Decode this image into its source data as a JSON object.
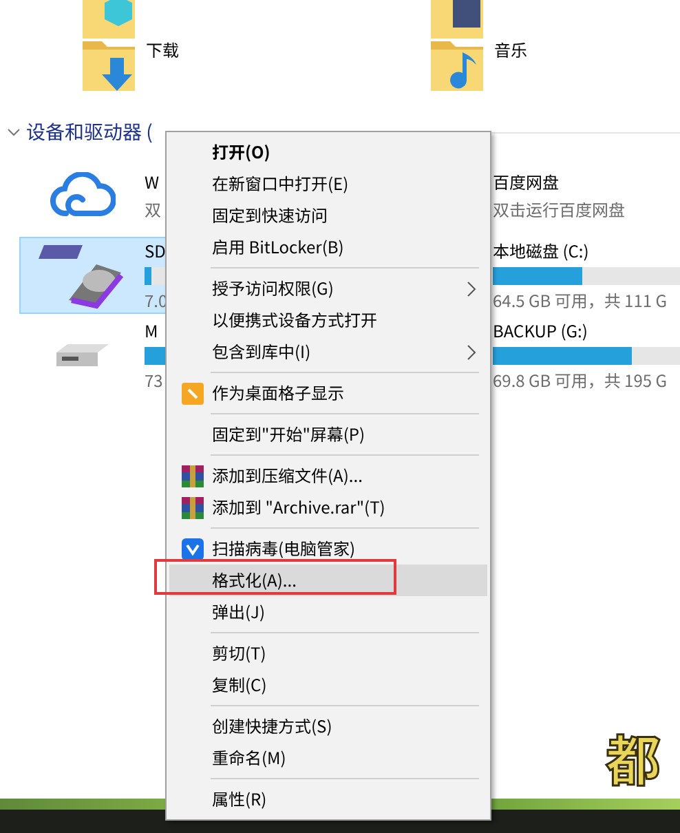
{
  "folders": [
    {
      "name": "下载",
      "kind": "download"
    },
    {
      "name": "音乐",
      "kind": "music"
    }
  ],
  "section": {
    "title": "设备和驱动器 (",
    "expanded": true
  },
  "drives": [
    {
      "name": "W",
      "detail": "双",
      "kind": "cloud",
      "selected": false
    },
    {
      "name": "百度网盘",
      "detail": "双击运行百度网盘",
      "selected": false
    },
    {
      "name": "SD",
      "detail": "7.0",
      "kind": "sd",
      "level": 0.03,
      "selected": true
    },
    {
      "name": "本地磁盘 (C:)",
      "detail": "64.5 GB 可用，共 111 G",
      "level": 0.42,
      "selected": false
    },
    {
      "name": "M",
      "detail": "73",
      "kind": "usb",
      "level": 0.6,
      "selected": false
    },
    {
      "name": "BACKUP (G:)",
      "detail": "69.8 GB 可用，共 195 G",
      "level": 0.65,
      "selected": false
    }
  ],
  "context_menu": [
    {
      "kind": "item",
      "label": "打开(O)",
      "bold": true,
      "highlighted": false
    },
    {
      "kind": "item",
      "label": "在新窗口中打开(E)",
      "highlighted": false
    },
    {
      "kind": "item",
      "label": "固定到快速访问",
      "highlighted": false
    },
    {
      "kind": "item",
      "label": "启用 BitLocker(B)",
      "highlighted": false
    },
    {
      "kind": "separator"
    },
    {
      "kind": "item",
      "label": "授予访问权限(G)",
      "submenu": true,
      "highlighted": false
    },
    {
      "kind": "item",
      "label": "以便携式设备方式打开",
      "highlighted": false
    },
    {
      "kind": "item",
      "label": "包含到库中(I)",
      "submenu": true,
      "highlighted": false
    },
    {
      "kind": "separator"
    },
    {
      "kind": "grid_item",
      "label": "作为桌面格子显示",
      "highlighted": false
    },
    {
      "kind": "separator"
    },
    {
      "kind": "item",
      "label": "固定到\"开始\"屏幕(P)",
      "highlighted": false
    },
    {
      "kind": "separator"
    },
    {
      "kind": "archive_item",
      "label": "添加到压缩文件(A)...",
      "highlighted": false
    },
    {
      "kind": "archive_item",
      "label": "添加到 \"Archive.rar\"(T)",
      "highlighted": false
    },
    {
      "kind": "separator"
    },
    {
      "kind": "shield_item",
      "label": "扫描病毒(电脑管家)",
      "highlighted": false
    },
    {
      "kind": "item",
      "label": "格式化(A)...",
      "highlighted": true,
      "annotated": true
    },
    {
      "kind": "item",
      "label": "弹出(J)",
      "highlighted": false
    },
    {
      "kind": "separator"
    },
    {
      "kind": "item",
      "label": "剪切(T)",
      "highlighted": false
    },
    {
      "kind": "item",
      "label": "复制(C)",
      "highlighted": false
    },
    {
      "kind": "separator"
    },
    {
      "kind": "item",
      "label": "创建快捷方式(S)",
      "highlighted": false
    },
    {
      "kind": "item",
      "label": "重命名(M)",
      "highlighted": false
    },
    {
      "kind": "separator"
    },
    {
      "kind": "item",
      "label": "属性(R)",
      "highlighted": false
    }
  ],
  "caption": "都"
}
